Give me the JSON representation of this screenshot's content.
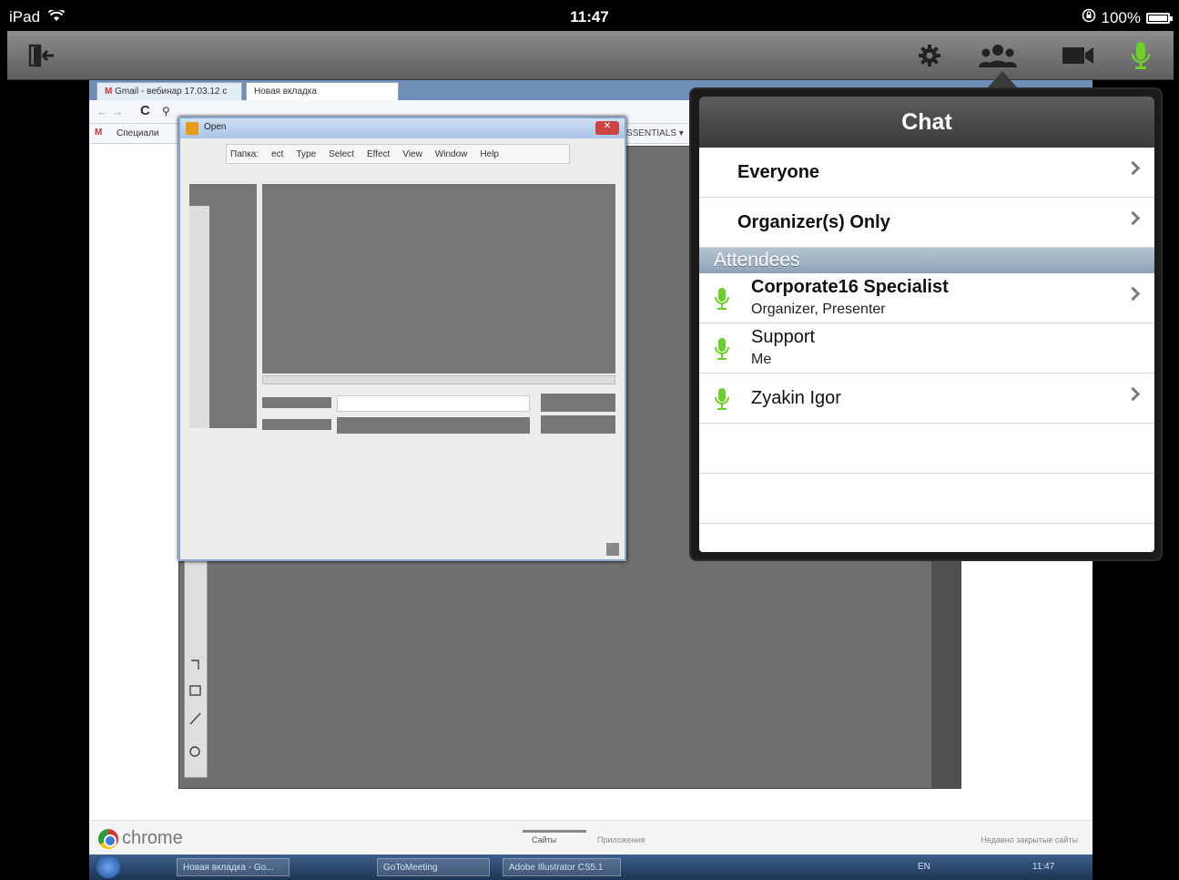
{
  "status_bar": {
    "carrier": "iPad",
    "time": "11:47",
    "battery": "100%"
  },
  "toolbar": {
    "exit_icon": "exit-icon",
    "settings_icon": "gear-icon",
    "attendees_icon": "people-icon",
    "camera_icon": "video-camera-icon",
    "mic_icon": "microphone-icon",
    "mic_color": "#6bd12a"
  },
  "shared_screen": {
    "tabs": [
      {
        "label": "Gmail - вебинар 17.03.12 с"
      },
      {
        "label": "Новая вкладка"
      }
    ],
    "bookmark_label": "Специали",
    "essentials_label": "SSENTIALS ▾",
    "dialog_title": "Open",
    "dialog_folder_label": "Папка:",
    "dialog_menu": [
      "ect",
      "Type",
      "Select",
      "Effect",
      "View",
      "Window",
      "Help"
    ],
    "chrome_word": "chrome",
    "footer_tabs": [
      "Сайты",
      "Приложения"
    ],
    "recently_closed": "Недавно закрытые сайты",
    "taskbar_items": [
      "Новая вкладка - Go...",
      "GoToMeeting",
      "Adobe Illustrator CS5.1"
    ],
    "taskbar_lang": "EN",
    "taskbar_time": "11:47"
  },
  "chat": {
    "title": "Chat",
    "options": [
      {
        "label": "Everyone"
      },
      {
        "label": "Organizer(s) Only"
      }
    ],
    "section_title": "Attendees",
    "attendees": [
      {
        "name": "Corporate16 Specialist",
        "role": "Organizer, Presenter",
        "bold": true,
        "chevron": true
      },
      {
        "name": "Support",
        "role": "Me",
        "bold": false,
        "chevron": false
      },
      {
        "name": "Zyakin Igor",
        "role": "",
        "bold": false,
        "chevron": true
      }
    ],
    "mic_color": "#6bd12a"
  }
}
